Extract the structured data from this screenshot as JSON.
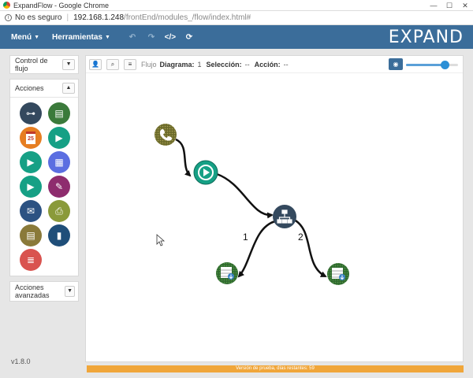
{
  "window": {
    "title": "ExpandFlow - Google Chrome"
  },
  "address": {
    "security": "No es seguro",
    "host": "192.168.1.248",
    "path": "/frontEnd/modules_/flow/index.html#"
  },
  "nav": {
    "menu_label": "Menú",
    "tools_label": "Herramientas",
    "logo": "EXPAND"
  },
  "sidebar": {
    "control_label": "Control de flujo",
    "actions_label": "Acciones",
    "advanced_label": "Acciones avanzadas",
    "version": "v1.8.0",
    "actions": [
      {
        "icon": "hierarchy-icon",
        "color": "#34495e"
      },
      {
        "icon": "database-download-icon",
        "color": "#3b7a3b"
      },
      {
        "icon": "calendar-icon",
        "color": "#e67e22",
        "text": "25"
      },
      {
        "icon": "play-icon",
        "color": "#16a085"
      },
      {
        "icon": "play-globe-icon",
        "color": "#16a085"
      },
      {
        "icon": "calculator-icon",
        "color": "#5b6ee1"
      },
      {
        "icon": "play-counter-icon",
        "color": "#16a085"
      },
      {
        "icon": "pencil-icon",
        "color": "#8e2c6e"
      },
      {
        "icon": "mail-icon",
        "color": "#2c5282"
      },
      {
        "icon": "printer-icon",
        "color": "#8a9a3a"
      },
      {
        "icon": "table-icon",
        "color": "#8a7a3a"
      },
      {
        "icon": "bar-chart-icon",
        "color": "#1f4e79"
      },
      {
        "icon": "document-icon",
        "color": "#d9534f"
      }
    ]
  },
  "toolbar": {
    "flow_label": "Flujo",
    "diagram_label": "Diagrama:",
    "diagram_value": "1",
    "selection_label": "Selección:",
    "selection_value": "--",
    "action_label": "Acción:",
    "action_value": "--"
  },
  "zoom": {
    "level": 0.75
  },
  "flow": {
    "edge_labels": [
      "1",
      "2"
    ]
  },
  "footer": {
    "trial_text": "Versión de prueba, días restantes: 59"
  }
}
